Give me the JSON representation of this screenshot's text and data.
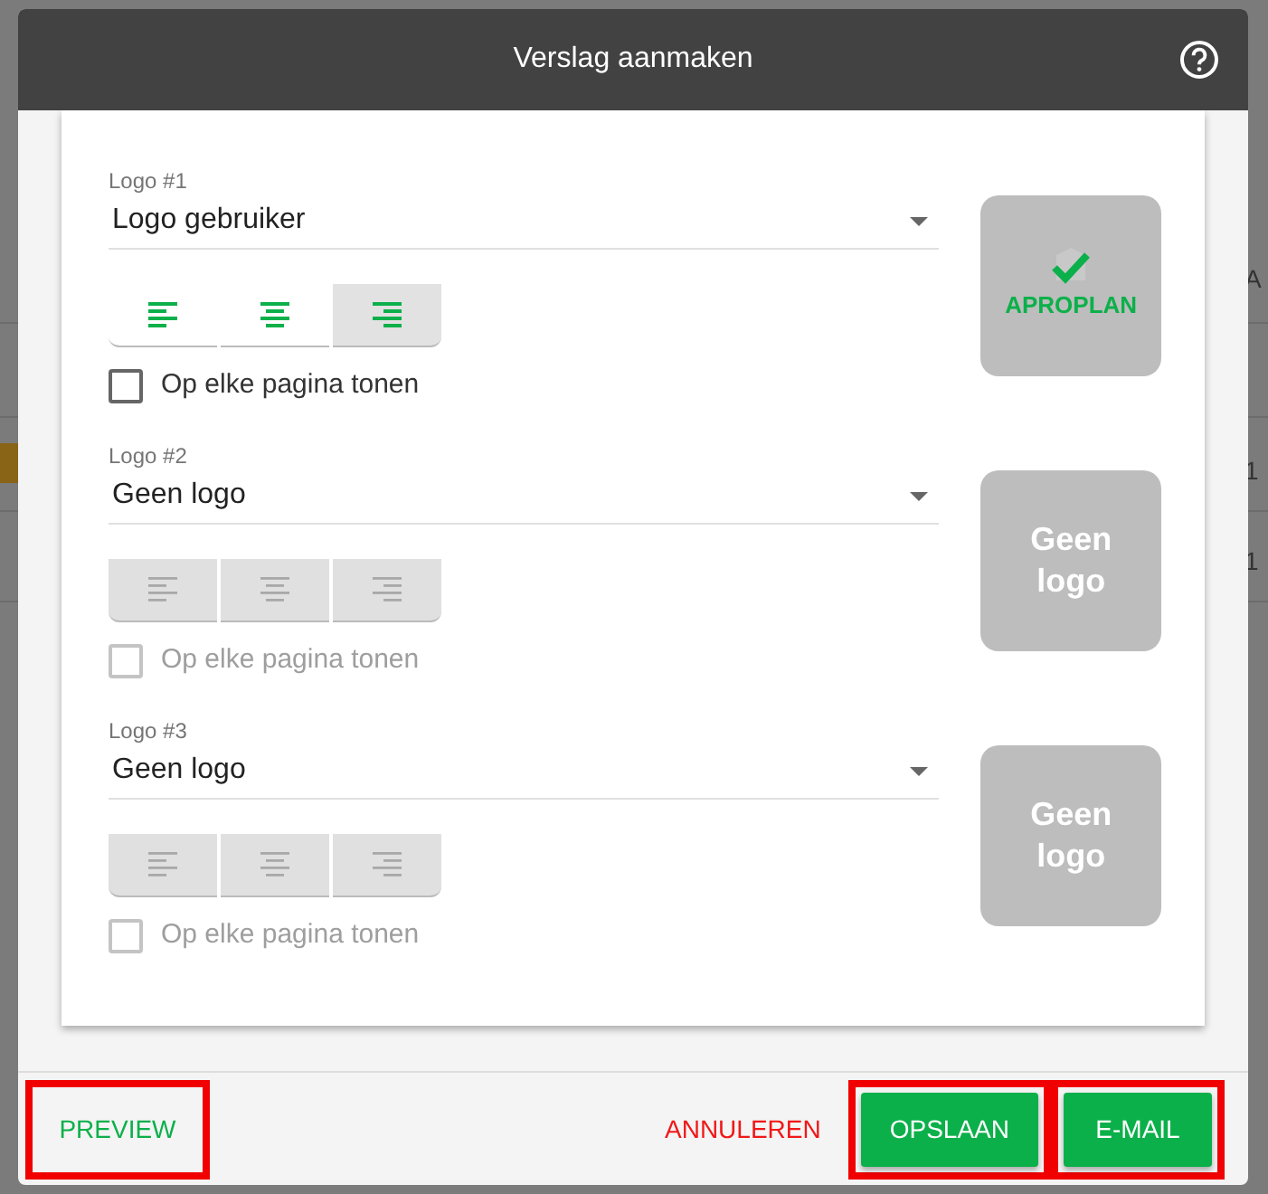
{
  "background": {
    "column_header": "A",
    "cells": [
      "1",
      "1"
    ]
  },
  "dialog": {
    "title": "Verslag aanmaken",
    "logos": [
      {
        "label": "Logo #1",
        "value": "Logo gebruiker",
        "disabled": false,
        "alignments": [
          {
            "kind": "left",
            "selected": false
          },
          {
            "kind": "center",
            "selected": false
          },
          {
            "kind": "right",
            "selected": true
          }
        ],
        "every_page": {
          "label": "Op elke pagina tonen",
          "checked": false
        },
        "preview": {
          "kind": "logo",
          "text": "APROPLAN"
        }
      },
      {
        "label": "Logo #2",
        "value": "Geen logo",
        "disabled": true,
        "alignments": [
          {
            "kind": "left",
            "selected": false
          },
          {
            "kind": "center",
            "selected": false
          },
          {
            "kind": "right",
            "selected": false
          }
        ],
        "every_page": {
          "label": "Op elke pagina tonen",
          "checked": false
        },
        "preview": {
          "kind": "none",
          "text": "Geen logo"
        }
      },
      {
        "label": "Logo #3",
        "value": "Geen logo",
        "disabled": true,
        "alignments": [
          {
            "kind": "left",
            "selected": false
          },
          {
            "kind": "center",
            "selected": false
          },
          {
            "kind": "right",
            "selected": false
          }
        ],
        "every_page": {
          "label": "Op elke pagina tonen",
          "checked": false
        },
        "preview": {
          "kind": "none",
          "text": "Geen logo"
        }
      }
    ],
    "footer": [
      {
        "label": "PREVIEW",
        "kind": "text",
        "highlighted": true
      },
      {
        "label": "ANNULEREN",
        "kind": "cancel",
        "highlighted": false
      },
      {
        "label": "OPSLAAN",
        "kind": "primary",
        "highlighted": true
      },
      {
        "label": "E-MAIL",
        "kind": "primary",
        "highlighted": true
      }
    ]
  }
}
